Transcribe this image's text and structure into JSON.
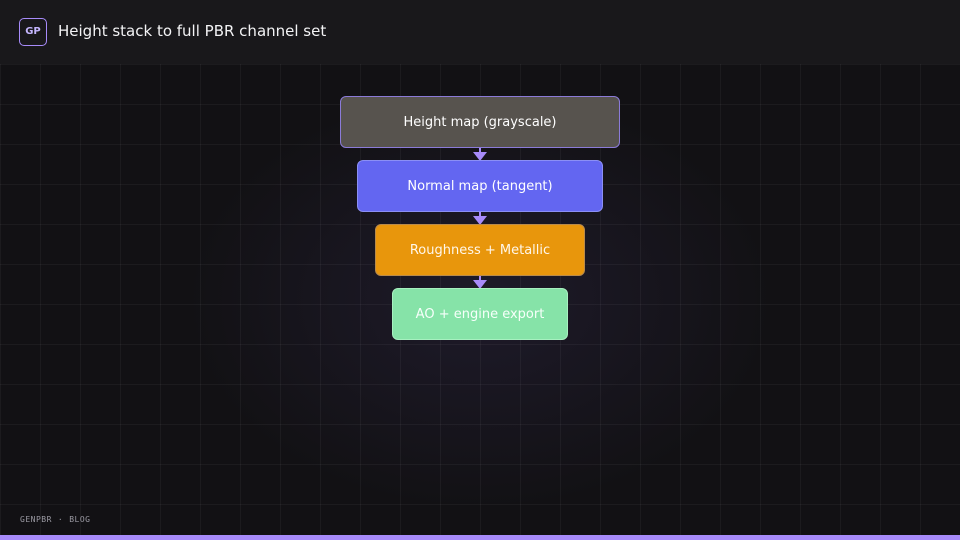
{
  "header": {
    "logo_text": "GP",
    "title": "Height stack to full PBR channel set"
  },
  "diagram": {
    "nodes": [
      {
        "label": "Height map (grayscale)",
        "color": "#57534e"
      },
      {
        "label": "Normal map (tangent)",
        "color": "#6366f1"
      },
      {
        "label": "Roughness + Metallic",
        "color": "#e8960c"
      },
      {
        "label": "AO + engine export",
        "color": "#86e3a8"
      }
    ],
    "edges": [
      {
        "from": "Height map (grayscale)",
        "to": "Normal map (tangent)"
      },
      {
        "from": "Normal map (tangent)",
        "to": "Roughness + Metallic"
      },
      {
        "from": "Roughness + Metallic",
        "to": "AO + engine export"
      }
    ],
    "arrow_color": "#a78bfa"
  },
  "footer": {
    "brand": "GENPBR",
    "separator": "·",
    "section": "BLOG"
  },
  "accent_color": "#a78bfa"
}
